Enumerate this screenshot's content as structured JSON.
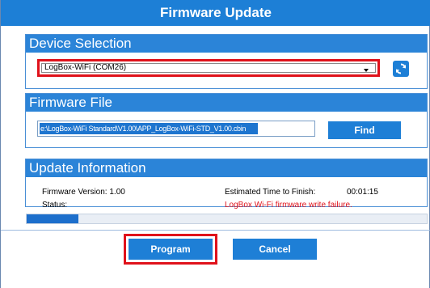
{
  "window": {
    "title": "Firmware Update"
  },
  "device_selection": {
    "header": "Device Selection",
    "selected_device": "LogBox-WiFi (COM26)",
    "refresh_icon": "refresh-icon"
  },
  "firmware_file": {
    "header": "Firmware File",
    "path": "e:\\LogBox-WiFi Standard\\V1.00\\APP_LogBox-WiFi-STD_V1.00.cbin",
    "find_label": "Find"
  },
  "update_information": {
    "header": "Update Information",
    "firmware_version_label": "Firmware Version: 1.00",
    "status_label": "Status:",
    "estimated_time_label": "Estimated Time to Finish:",
    "estimated_time_value": "00:01:15",
    "status_message": "LogBox Wi-Fi firmware write failure."
  },
  "progress": {
    "fraction": 0.13
  },
  "actions": {
    "program_label": "Program",
    "cancel_label": "Cancel"
  },
  "colors": {
    "accent": "#1d7fd6",
    "highlight": "#e0121b"
  }
}
